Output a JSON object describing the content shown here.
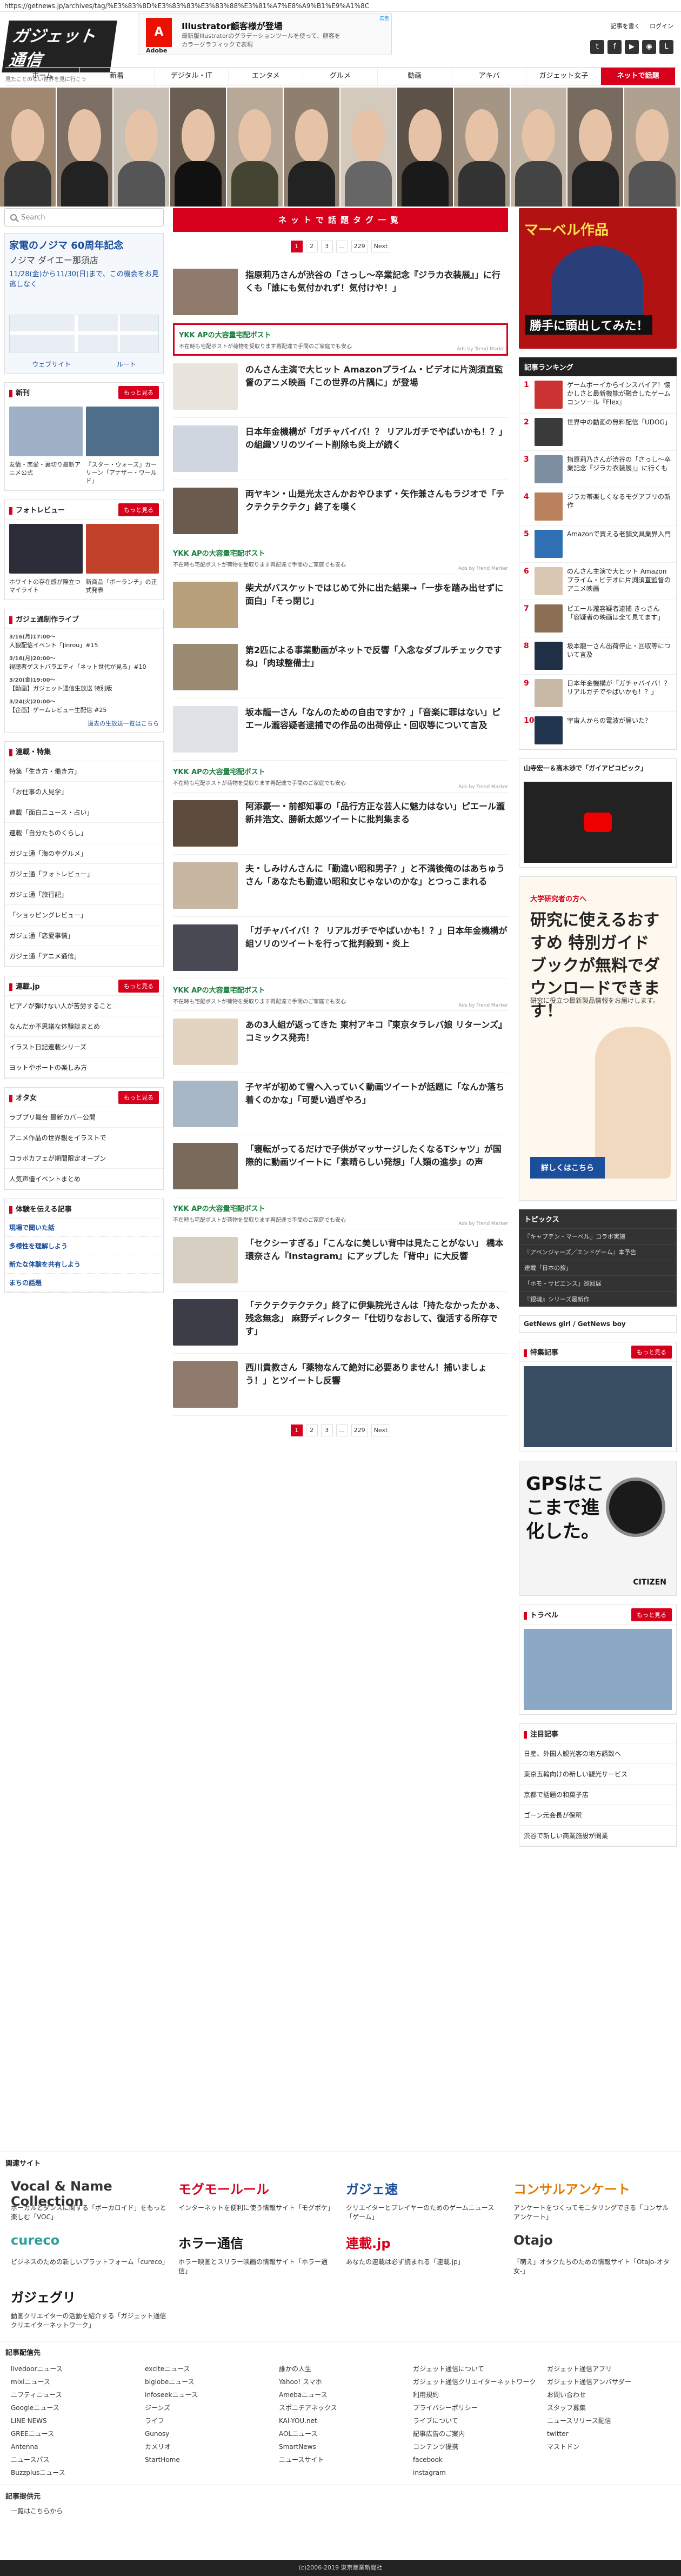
{
  "url": "https://getnews.jp/archives/tag/%E3%83%8D%E3%83%83%E3%83%88%E3%81%A7%E8%A9%B1%E9%A1%8C",
  "logo": {
    "main": "ガジェット通信",
    "sub": "見たことのない世界を見に行こう"
  },
  "top_ad": {
    "brand": "Adobe",
    "badge": "広告",
    "title": "Illustrator顧客様が登場",
    "text": "最新版Illustratorのグラデーションツールを使って、顧客をカラーグラフィックで表現"
  },
  "top_links": [
    "記事を書く",
    "ログイン"
  ],
  "social_icons": [
    "twitter-icon",
    "facebook-icon",
    "youtube-icon",
    "rss-icon",
    "line-icon"
  ],
  "nav": [
    "ホーム",
    "新着",
    "デジタル・IT",
    "エンタメ",
    "グルメ",
    "動画",
    "アキバ",
    "ガジェット女子",
    "ネットで話題"
  ],
  "search": {
    "placeholder": "Search"
  },
  "map_ad": {
    "title": "家電のノジマ 60周年記念",
    "subtitle": "ノジマ ダイエー那須店",
    "text": "11/28(金)から11/30(日)まで、この機会をお見逃しなく",
    "btn1": "ウェブサイト",
    "btn2": "ルート"
  },
  "section_news": {
    "title": "新刊",
    "more": "もっと見る"
  },
  "news_captions": [
    "友情・恋愛・裏切り最新アニメ公式",
    "『スター・ウォーズ』カーリーン「アナザー・ワールド」"
  ],
  "section_photo": {
    "title": "フォトレビュー",
    "more": "もっと見る"
  },
  "photo_captions": [
    "ホワイトの存在感が際立つマイライト",
    "新商品「ボーランチ」の正式発表"
  ],
  "timeline": {
    "title": "ガジェ通制作ライブ",
    "items": [
      {
        "time": "3/16(月)17:00〜",
        "text": "人狼配信イベント「Jinrou」#15"
      },
      {
        "time": "3/16(月)20:00〜",
        "text": "視聴者ゲストバラエティ「ネット世代が見る」#10"
      },
      {
        "time": "3/20(金)19:00〜",
        "text": "【動画】ガジェット通信生放送 特別版"
      },
      {
        "time": "3/24(火)20:00〜",
        "text": "【企画】ゲームレビュー生配信 #25"
      }
    ],
    "more": "過去の生放送一覧はこちら"
  },
  "section_feature": {
    "title": "連載・特集",
    "items": [
      "特集「生き方・働き方」",
      "「お仕事の人見学」",
      "連載「面白ニュース・占い」",
      "連載「自分たちのくらし」",
      "ガジェ通「海の幸グルメ」",
      "ガジェ通「フォトレビュー」",
      "ガジェ通「旅行記」",
      "「ショッピングレビュー」",
      "ガジェ通「恋愛事情」",
      "ガジェ通「アニメ通信」"
    ]
  },
  "section_renn": {
    "title": "連載.jp",
    "more": "もっと見る",
    "items": [
      "ピアノが弾けない人が苦労すること",
      "なんだか不思議な体験談まとめ",
      "イラスト日記連載シリーズ",
      "ヨットやボートの楽しみ方"
    ]
  },
  "section_otaku": {
    "title": "オタ女",
    "more": "もっと見る",
    "items": [
      "ラブプリ舞台 最新カバー公開",
      "アニメ作品の世界観をイラストで",
      "コラボカフェが期間限定オープン",
      "人気声優イベントまとめ"
    ]
  },
  "recommend": {
    "title": "体験を伝える記事",
    "items": [
      "現場で聞いた話",
      "多様性を理解しよう",
      "新たな体験を共有しよう",
      "まちの話題"
    ]
  },
  "tag_title": "ネットで話題タグ一覧",
  "pager": {
    "p1": "1",
    "p2": "2",
    "p3": "3",
    "dots": "...",
    "plast": "229",
    "next": "Next"
  },
  "articles": [
    {
      "kind": "article",
      "title": "指原莉乃さんが渋谷の「さっし～卒業記念『ジラカ衣装展』」に行くも「誰にも気付かれず！気付けや！」"
    },
    {
      "kind": "pr",
      "boxed": true,
      "title": "YKK APの大容量宅配ボスト",
      "desc": "不在時も宅配ボストが荷物を受取ります再配達で手間のご家庭でも安心",
      "badge": "Ads by Trend Marker"
    },
    {
      "kind": "article",
      "title": "のんさん主演で大ヒット Amazonプライム・ビデオに片渕須直監督のアニメ映画「この世界の片隅に」が登場"
    },
    {
      "kind": "article",
      "title": "日本年金機構が「ガチャバイバ！？ リアルガチでやばいかも！？」の組織ソリのツイート削除も炎上が続く"
    },
    {
      "kind": "article",
      "title": "両ヤキン・山是光太さんかおやひまず・矢作兼さんもラジオで「テクテクテクテク」終了を嘆く"
    },
    {
      "kind": "pr",
      "boxed": false,
      "title": "YKK APの大容量宅配ボスト",
      "desc": "不在時も宅配ボストが荷物を受取ります再配達で手間のご家庭でも安心",
      "badge": "Ads by Trend Marker"
    },
    {
      "kind": "article",
      "title": "柴犬がバスケットではじめて外に出た結果→「一歩を踏み出せずに面白」「そっ閉じ」"
    },
    {
      "kind": "article",
      "title": "第2匹による事業動画がネットで反響「入念なダブルチェックですね」「肉球整備士」"
    },
    {
      "kind": "article",
      "title": "坂本龍一さん「なんのための自由ですか？」「音楽に罪はない」ピエール瀧容疑者逮捕での作品の出荷停止・回収等について言及"
    },
    {
      "kind": "pr",
      "boxed": false,
      "title": "YKK APの大容量宅配ボスト",
      "desc": "不在時も宅配ボストが荷物を受取ります再配達で手間のご家庭でも安心",
      "badge": "Ads by Trend Marker"
    },
    {
      "kind": "article",
      "title": "阿添豪一・前都知事の「品行方正な芸人に魅力はない」ピエール瀧 新井浩文、勝新太郎ツイートに批判集まる"
    },
    {
      "kind": "article",
      "title": "夫・しみけんさんに「勤違い昭和男子？」と不満後俺のはあちゅうさん「あなたも勤違い昭和女じゃないのかな」とつっこまれる"
    },
    {
      "kind": "article",
      "title": "「ガチャバイバ！？ リアルガチでやばいかも！？」日本年金機構が組ソリのツイートを行って批判殺到・炎上"
    },
    {
      "kind": "pr",
      "boxed": false,
      "title": "YKK APの大容量宅配ボスト",
      "desc": "不在時も宅配ボストが荷物を受取ります再配達で手間のご家庭でも安心",
      "badge": "Ads by Trend Marker"
    },
    {
      "kind": "article",
      "title": "あの3人組が返ってきた 東村アキコ『東京タラレバ娘 リターンズ』コミックス発売！"
    },
    {
      "kind": "article",
      "title": "子ヤギが初めて雪へ入っていく動画ツイートが話題に「なんか落ち着くのかな」「可愛い過ぎやろ」"
    },
    {
      "kind": "article",
      "title": "「寝転がってるだけで子供がマッサージしたくなるTシャツ」が国際的に動画ツイートに「素晴らしい発想」「人類の進歩」の声"
    },
    {
      "kind": "pr",
      "boxed": false,
      "title": "YKK APの大容量宅配ボスト",
      "desc": "不在時も宅配ボストが荷物を受取ります再配達で手間のご家庭でも安心",
      "badge": "Ads by Trend Marker"
    },
    {
      "kind": "article",
      "title": "「セクシーすぎる」「こんなに美しい背中は見たことがない」 橋本環奈さん『Instagram』にアップした「背中」に大反響"
    },
    {
      "kind": "article",
      "title": "「テクテクテクテク」終了に伊集院光さんは「持たなかったかぁ、残念無念」 麻野ディレクター「仕切りなおして、復活する所存です」"
    },
    {
      "kind": "article",
      "title": "西川貴教さん「薬物なんて絶対に必要ありません！捕いましょう！」とツイートし反響"
    }
  ],
  "right_ad": {
    "line1": "マーベル作品",
    "line2": "勝手に頭出してみた！"
  },
  "ranking": {
    "title": "記事ランキング",
    "items": [
      "ゲームボーイからインスパイア！懐かしさと最新機能が融合したゲームコンソール『Flex』",
      "世界中の動画の無料配信「UDOG」",
      "指原莉乃さんが渋谷の「さっし～卒業記念『ジラカ衣装展』」に行くも",
      "ジラカ帯楽しくなるモグアプリの新作",
      "Amazonで買える老舗文具業界入門",
      "のんさん主演で大ヒット Amazonプライム・ビデオに片渕須直監督のアニメ映画",
      "ピエール瀧容疑者逮捕 きっさん「容疑者の映画は全て見てます」",
      "坂本龍一さん出荷停止・回収等について言及",
      "日本年金機構が「ガチャバイバ！？ リアルガチでやばいかも！？」",
      "宇宙人からの電波が届いた？"
    ]
  },
  "gaipico": {
    "title": "山寺宏一＆高木渉で「ガイアピコピック」"
  },
  "big_ad": {
    "sub": "大学研究者の方へ",
    "title": "研究に使えるおすすめ 特別ガイドブックが無料でダウンロードできます！",
    "text": "研究に役立つ最新製品情報をお届けします。",
    "cta": "詳しくはこちら"
  },
  "topics": {
    "title": "トピックス",
    "items": [
      "『キャプテン・マーベル』コラボ実施",
      "『アベンジャーズ／エンドゲーム』本予告",
      "連載「日本の旅」",
      "「ホモ・サピエンス」巡回展",
      "『銀魂』シリーズ最新作"
    ]
  },
  "getnews_boy": "GetNews girl / GetNews boy",
  "special": {
    "title": "特集記事",
    "more": "もっと見る"
  },
  "gps_ad": {
    "title": "GPSはここまで進化した。",
    "brand": "CITIZEN"
  },
  "travel": {
    "title": "トラベル",
    "more": "もっと見る"
  },
  "pickup": {
    "title": "注目記事",
    "items": [
      "日産、外国人観光客の地方誘致へ",
      "東京五輪向けの新しい観光サービス",
      "京都で話題の和菓子店",
      "ゴーン元会長が保釈",
      "渋谷で新しい商業施設が開業"
    ]
  },
  "related": {
    "title": "関連サイト",
    "items": [
      {
        "logo": "Vocal & Name Collection",
        "text": "ボーカルとダンスに関する「ボーカロイド」をもっと楽しむ「VOC」"
      },
      {
        "logo": "モグモールール",
        "text": "インターネットを便利に使う情報サイト「モグポケ」"
      },
      {
        "logo": "ガジェ速",
        "text": "クリエイターとプレイヤーのためのゲームニュース「ゲーム」"
      },
      {
        "logo": "コンサルアンケート",
        "text": "アンケートをつくってモニタリングできる「コンサルアンケート」"
      },
      {
        "logo": "cureco",
        "text": "ビジネスのための新しいプラットフォーム「cureco」"
      },
      {
        "logo": "ホラー通信",
        "text": "ホラー映画とスリラー映画の情報サイト「ホラー通信」"
      },
      {
        "logo": "連載.jp",
        "text": "あなたの連載は必ず読まれる「連載.jp」"
      },
      {
        "logo": "Otajo",
        "text": "「萌え」オタクたちのための情報サイト「Otajo-オタ女-」"
      },
      {
        "logo": "ガジェグリ",
        "text": "動画クリエイターの活動を紹介する「ガジェット通信クリエイターネットワーク」"
      }
    ]
  },
  "footer_links": {
    "title": "記事配信先",
    "cols": [
      [
        "livedoorニュース",
        "mixiニュース",
        "ニフティニュース",
        "Googleニュース",
        "LINE NEWS",
        "GREEニュース",
        "Antenna",
        "ニュースパス",
        "Buzzplusニュース"
      ],
      [
        "exciteニュース",
        "biglobeニュース",
        "infoseekニュース",
        "ジーンズ",
        "ライフ",
        "Gunosy",
        "カメリオ",
        "StartHome"
      ],
      [
        "誰かの人生",
        "Yahoo! スマホ",
        "Amebaニュース",
        "スポニチアネックス",
        "KAI-YOU.net",
        "AOLニュース",
        "SmartNews",
        "ニュースサイト"
      ],
      [
        "ガジェット通信について",
        "ガジェット通信クリエイターネットワーク",
        "利用規約",
        "プライバシーポリシー",
        "ライブについて",
        "記事広告のご案内",
        "コンテンツ提携",
        "facebook",
        "instagram"
      ],
      [
        "ガジェット通信アプリ",
        "ガジェット通信アンバサダー",
        "お問い合わせ",
        "スタッフ募集",
        "ニュースリリース配信",
        "twitter",
        "マストドン"
      ]
    ]
  },
  "footer_links2": {
    "title": "記事提供元",
    "item": "一覧はこちらから"
  },
  "copyright": "(c)2006-2019 東京産業新聞社"
}
